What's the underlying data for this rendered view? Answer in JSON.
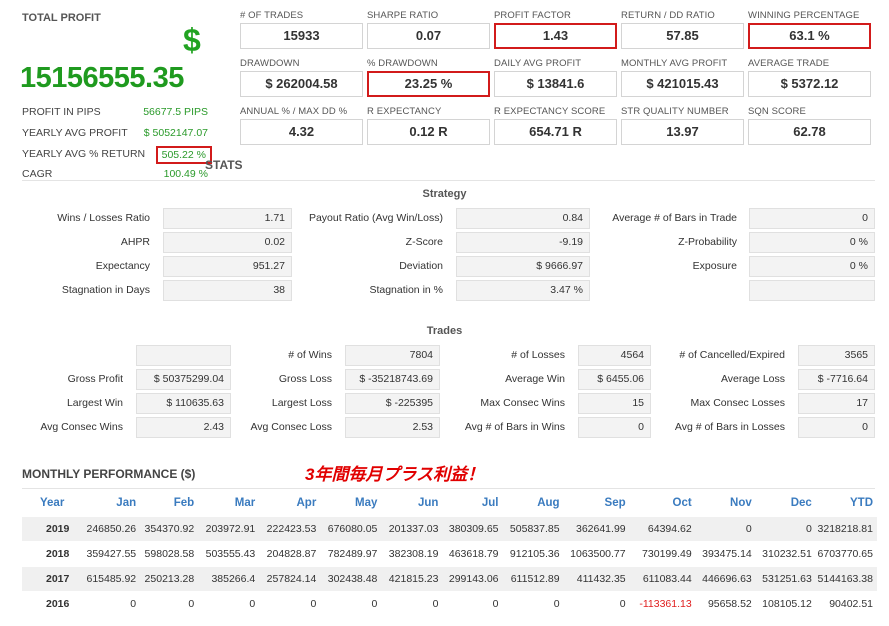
{
  "summary": {
    "total_profit_label": "TOTAL PROFIT",
    "currency_symbol": "$",
    "total_profit_value": "15156555.35",
    "rows": [
      {
        "label": "PROFIT IN PIPS",
        "value": "56677.5 PIPS"
      },
      {
        "label": "YEARLY AVG PROFIT",
        "value": "$ 5052147.07"
      },
      {
        "label": "YEARLY AVG % RETURN",
        "value": "505.22 %"
      },
      {
        "label": "CAGR",
        "value": "100.49 %"
      }
    ]
  },
  "metrics": [
    {
      "label": "# OF TRADES",
      "value": "15933"
    },
    {
      "label": "SHARPE RATIO",
      "value": "0.07"
    },
    {
      "label": "PROFIT FACTOR",
      "value": "1.43"
    },
    {
      "label": "RETURN / DD RATIO",
      "value": "57.85"
    },
    {
      "label": "WINNING PERCENTAGE",
      "value": "63.1 %"
    },
    {
      "label": "DRAWDOWN",
      "value": "$ 262004.58"
    },
    {
      "label": "% DRAWDOWN",
      "value": "23.25 %"
    },
    {
      "label": "DAILY AVG PROFIT",
      "value": "$ 13841.6"
    },
    {
      "label": "MONTHLY AVG PROFIT",
      "value": "$ 421015.43"
    },
    {
      "label": "AVERAGE TRADE",
      "value": "$ 5372.12"
    },
    {
      "label": "ANNUAL % / MAX DD %",
      "value": "4.32"
    },
    {
      "label": "R EXPECTANCY",
      "value": "0.12 R"
    },
    {
      "label": "R EXPECTANCY SCORE",
      "value": "654.71 R"
    },
    {
      "label": "STR QUALITY NUMBER",
      "value": "13.97"
    },
    {
      "label": "SQN SCORE",
      "value": "62.78"
    }
  ],
  "stats": {
    "title": "STATS",
    "strategy_title": "Strategy",
    "strategy": [
      {
        "label": "Wins / Losses Ratio",
        "value": "1.71"
      },
      {
        "label": "Payout Ratio (Avg Win/Loss)",
        "value": "0.84"
      },
      {
        "label": "Average # of Bars in Trade",
        "value": "0"
      },
      {
        "label": "AHPR",
        "value": "0.02"
      },
      {
        "label": "Z-Score",
        "value": "-9.19"
      },
      {
        "label": "Z-Probability",
        "value": "0 %"
      },
      {
        "label": "Expectancy",
        "value": "951.27"
      },
      {
        "label": "Deviation",
        "value": "$ 9666.97"
      },
      {
        "label": "Exposure",
        "value": "0 %"
      },
      {
        "label": "Stagnation in Days",
        "value": "38"
      },
      {
        "label": "Stagnation in %",
        "value": "3.47 %"
      },
      {
        "label": "",
        "value": ""
      }
    ],
    "trades_title": "Trades",
    "trades": [
      {
        "label": "",
        "value": ""
      },
      {
        "label": "# of Wins",
        "value": "7804"
      },
      {
        "label": "# of Losses",
        "value": "4564"
      },
      {
        "label": "# of Cancelled/Expired",
        "value": "3565"
      },
      {
        "label": "Gross Profit",
        "value": "$ 50375299.04"
      },
      {
        "label": "Gross Loss",
        "value": "$ -35218743.69"
      },
      {
        "label": "Average Win",
        "value": "$ 6455.06"
      },
      {
        "label": "Average Loss",
        "value": "$ -7716.64"
      },
      {
        "label": "Largest Win",
        "value": "$ 110635.63"
      },
      {
        "label": "Largest Loss",
        "value": "$ -225395"
      },
      {
        "label": "Max Consec Wins",
        "value": "15"
      },
      {
        "label": "Max Consec Losses",
        "value": "17"
      },
      {
        "label": "Avg Consec Wins",
        "value": "2.43"
      },
      {
        "label": "Avg Consec Loss",
        "value": "2.53"
      },
      {
        "label": "Avg # of Bars in Wins",
        "value": "0"
      },
      {
        "label": "Avg # of Bars in Losses",
        "value": "0"
      }
    ]
  },
  "monthly": {
    "title": "MONTHLY PERFORMANCE ($)",
    "annotation": "3年間毎月プラス利益！",
    "headers": [
      "Year",
      "Jan",
      "Feb",
      "Mar",
      "Apr",
      "May",
      "Jun",
      "Jul",
      "Aug",
      "Sep",
      "Oct",
      "Nov",
      "Dec",
      "YTD"
    ],
    "rows": [
      [
        "2019",
        "246850.26",
        "354370.92",
        "203972.91",
        "222423.53",
        "676080.05",
        "201337.03",
        "380309.65",
        "505837.85",
        "362641.99",
        "64394.62",
        "0",
        "0",
        "3218218.81"
      ],
      [
        "2018",
        "359427.55",
        "598028.58",
        "503555.43",
        "204828.87",
        "782489.97",
        "382308.19",
        "463618.79",
        "912105.36",
        "1063500.77",
        "730199.49",
        "393475.14",
        "310232.51",
        "6703770.65"
      ],
      [
        "2017",
        "615485.92",
        "250213.28",
        "385266.4",
        "257824.14",
        "302438.48",
        "421815.23",
        "299143.06",
        "611512.89",
        "411432.35",
        "611083.44",
        "446696.63",
        "531251.63",
        "5144163.38"
      ],
      [
        "2016",
        "0",
        "0",
        "0",
        "0",
        "0",
        "0",
        "0",
        "0",
        "0",
        "-113361.13",
        "95658.52",
        "108105.12",
        "90402.51"
      ]
    ],
    "negative_color": "#e02020"
  }
}
